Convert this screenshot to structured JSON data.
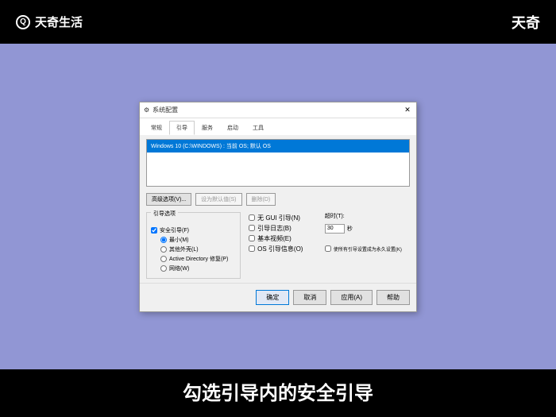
{
  "brand": {
    "name": "天奇生活",
    "right": "天奇"
  },
  "dialog": {
    "title": "系统配置",
    "close": "✕",
    "tabs": {
      "general": "常规",
      "boot": "引导",
      "services": "服务",
      "startup": "启动",
      "tools": "工具"
    },
    "osEntry": "Windows 10 (C:\\WINDOWS) : 当前 OS; 默认 OS",
    "buttons": {
      "advanced": "高级选项(V)...",
      "setDefault": "设为默认值(S)",
      "delete": "删除(D)"
    },
    "bootOptions": {
      "title": "引导选项",
      "safeBoot": "安全引导(F)",
      "minimal": "最小(M)",
      "altShell": "其他外壳(L)",
      "adRepair": "Active Directory 修复(P)",
      "network": "网络(W)"
    },
    "rightOptions": {
      "noGui": "无 GUI 引导(N)",
      "bootLog": "引导日志(B)",
      "baseVideo": "基本视频(E)",
      "osBootInfo": "OS 引导信息(O)"
    },
    "timeout": {
      "label": "超时(T):",
      "value": "30",
      "unit": "秒"
    },
    "permanent": "使所有引导设置成为永久设置(K)",
    "bottomButtons": {
      "ok": "确定",
      "cancel": "取消",
      "apply": "应用(A)",
      "help": "帮助"
    }
  },
  "subtitle": "勾选引导内的安全引导"
}
